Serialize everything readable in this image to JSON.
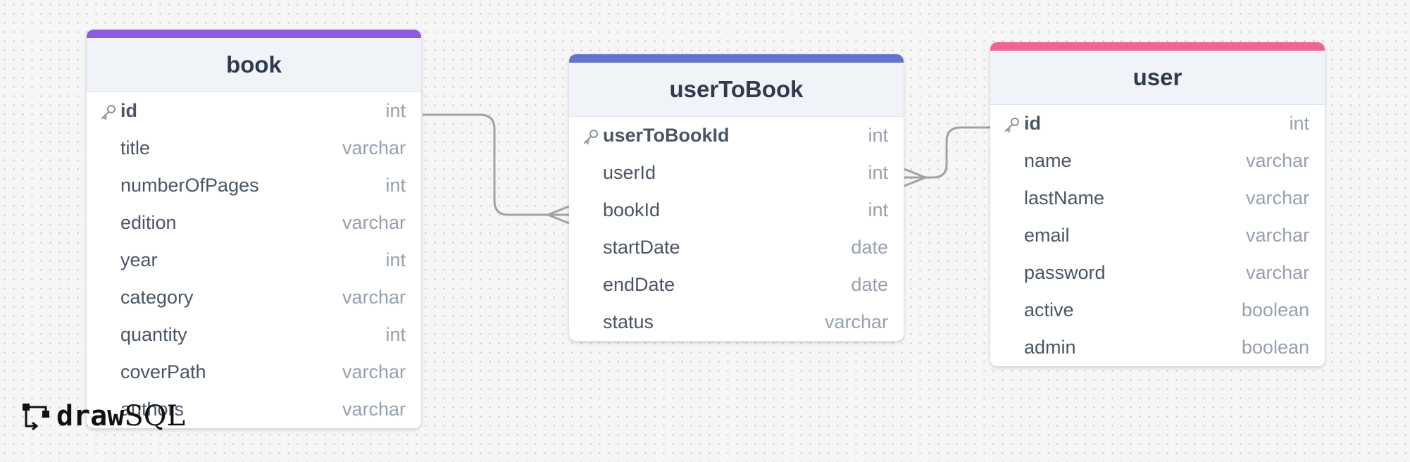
{
  "tables": [
    {
      "title": "book",
      "accent": "#8c5ce0",
      "rows": [
        {
          "name": "id",
          "type": "int",
          "pk": true
        },
        {
          "name": "title",
          "type": "varchar"
        },
        {
          "name": "numberOfPages",
          "type": "int"
        },
        {
          "name": "edition",
          "type": "varchar"
        },
        {
          "name": "year",
          "type": "int"
        },
        {
          "name": "category",
          "type": "varchar"
        },
        {
          "name": "quantity",
          "type": "int"
        },
        {
          "name": "coverPath",
          "type": "varchar"
        },
        {
          "name": "authors",
          "type": "varchar"
        }
      ]
    },
    {
      "title": "userToBook",
      "accent": "#6574cf",
      "rows": [
        {
          "name": "userToBookId",
          "type": "int",
          "pk": true
        },
        {
          "name": "userId",
          "type": "int"
        },
        {
          "name": "bookId",
          "type": "int"
        },
        {
          "name": "startDate",
          "type": "date"
        },
        {
          "name": "endDate",
          "type": "date"
        },
        {
          "name": "status",
          "type": "varchar"
        }
      ]
    },
    {
      "title": "user",
      "accent": "#f0658f",
      "rows": [
        {
          "name": "id",
          "type": "int",
          "pk": true
        },
        {
          "name": "name",
          "type": "varchar"
        },
        {
          "name": "lastName",
          "type": "varchar"
        },
        {
          "name": "email",
          "type": "varchar"
        },
        {
          "name": "password",
          "type": "varchar"
        },
        {
          "name": "active",
          "type": "boolean"
        },
        {
          "name": "admin",
          "type": "boolean"
        }
      ]
    }
  ],
  "relationships": [
    {
      "from": "book.id",
      "to": "userToBook.bookId",
      "cardinality": "one-to-many"
    },
    {
      "from": "user.id",
      "to": "userToBook.userId",
      "cardinality": "one-to-many"
    }
  ],
  "logo": {
    "word_bold": "draw",
    "word_light": "SQL"
  },
  "colors": {
    "connector": "#9ea3a8",
    "key_icon": "#8a929c"
  }
}
